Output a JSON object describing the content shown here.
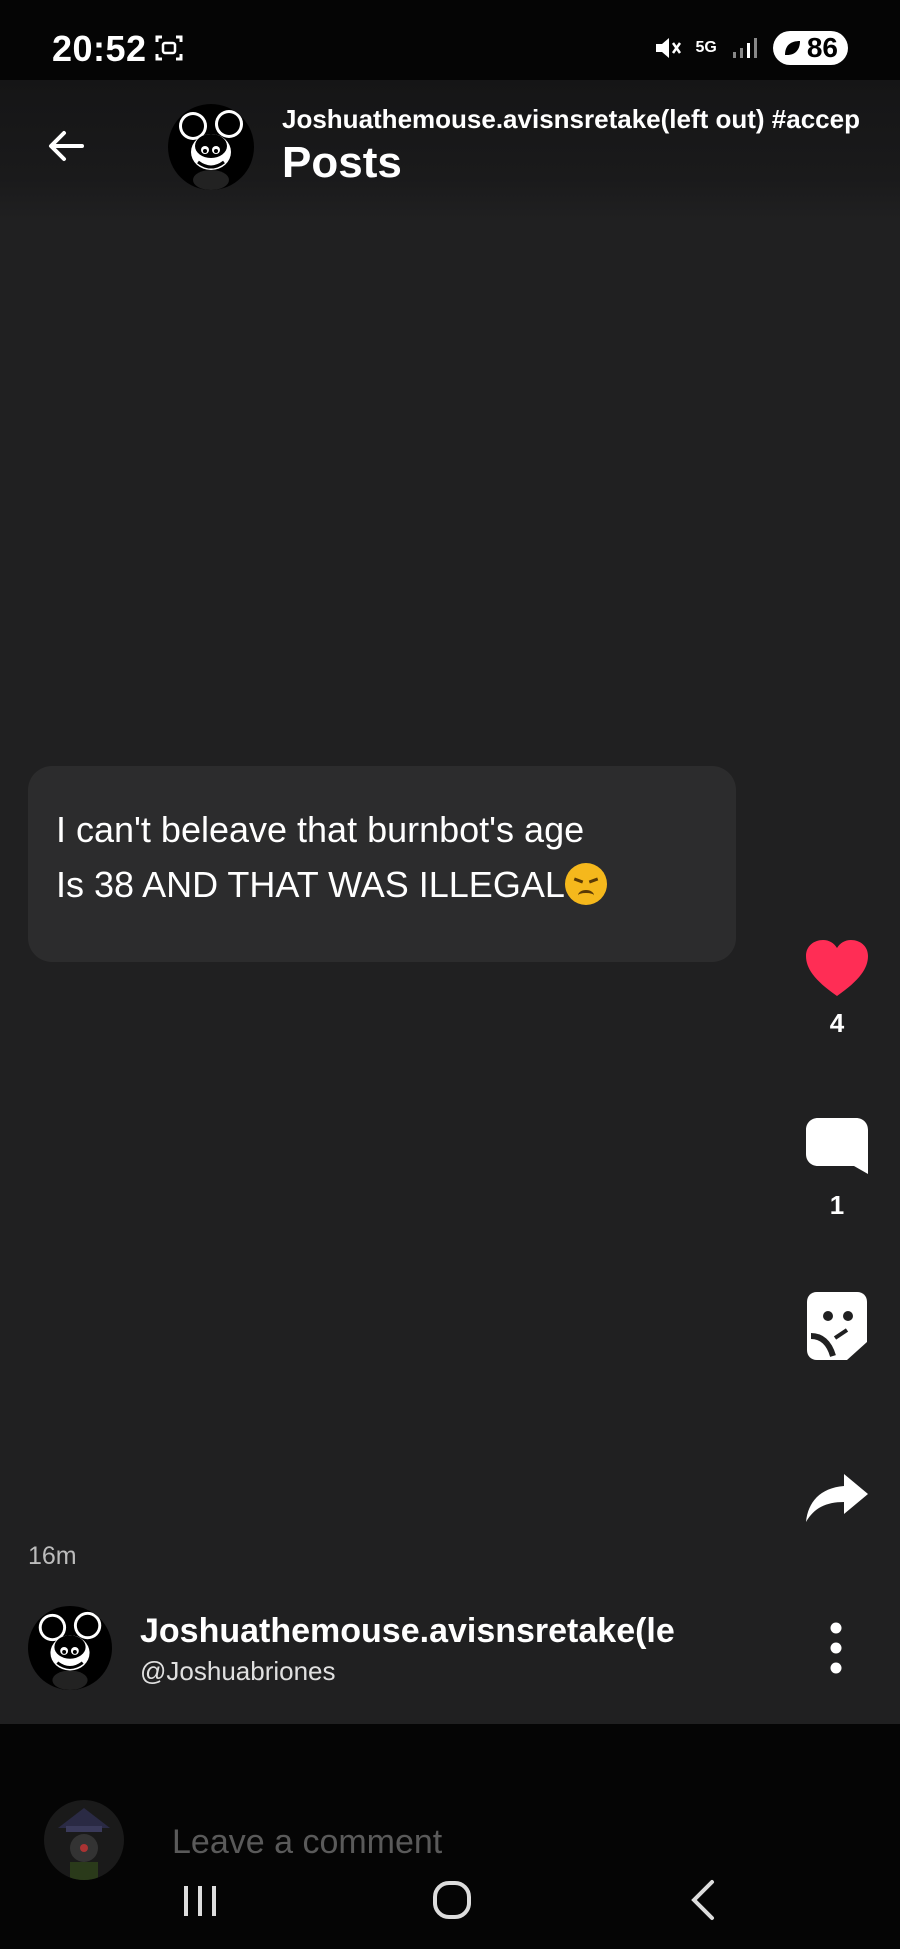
{
  "status_bar": {
    "time": "20:52",
    "network": "5G",
    "battery": "86"
  },
  "header": {
    "community": "Joshuathemouse.avisnsretake(left out) #accep",
    "title": "Posts"
  },
  "post": {
    "line1": "I can't beleave that burnbot's age",
    "line2": "Is 38 AND THAT WAS ILLEGAL",
    "emoji": "disappointed-face",
    "time_ago": "16m"
  },
  "actions": {
    "likes": "4",
    "comments": "1",
    "like_color": "#ff2d55"
  },
  "author": {
    "name": "Joshuathemouse.avisnsretake(le",
    "handle": "@Joshuabriones"
  },
  "comment_box": {
    "placeholder": "Leave a comment"
  }
}
